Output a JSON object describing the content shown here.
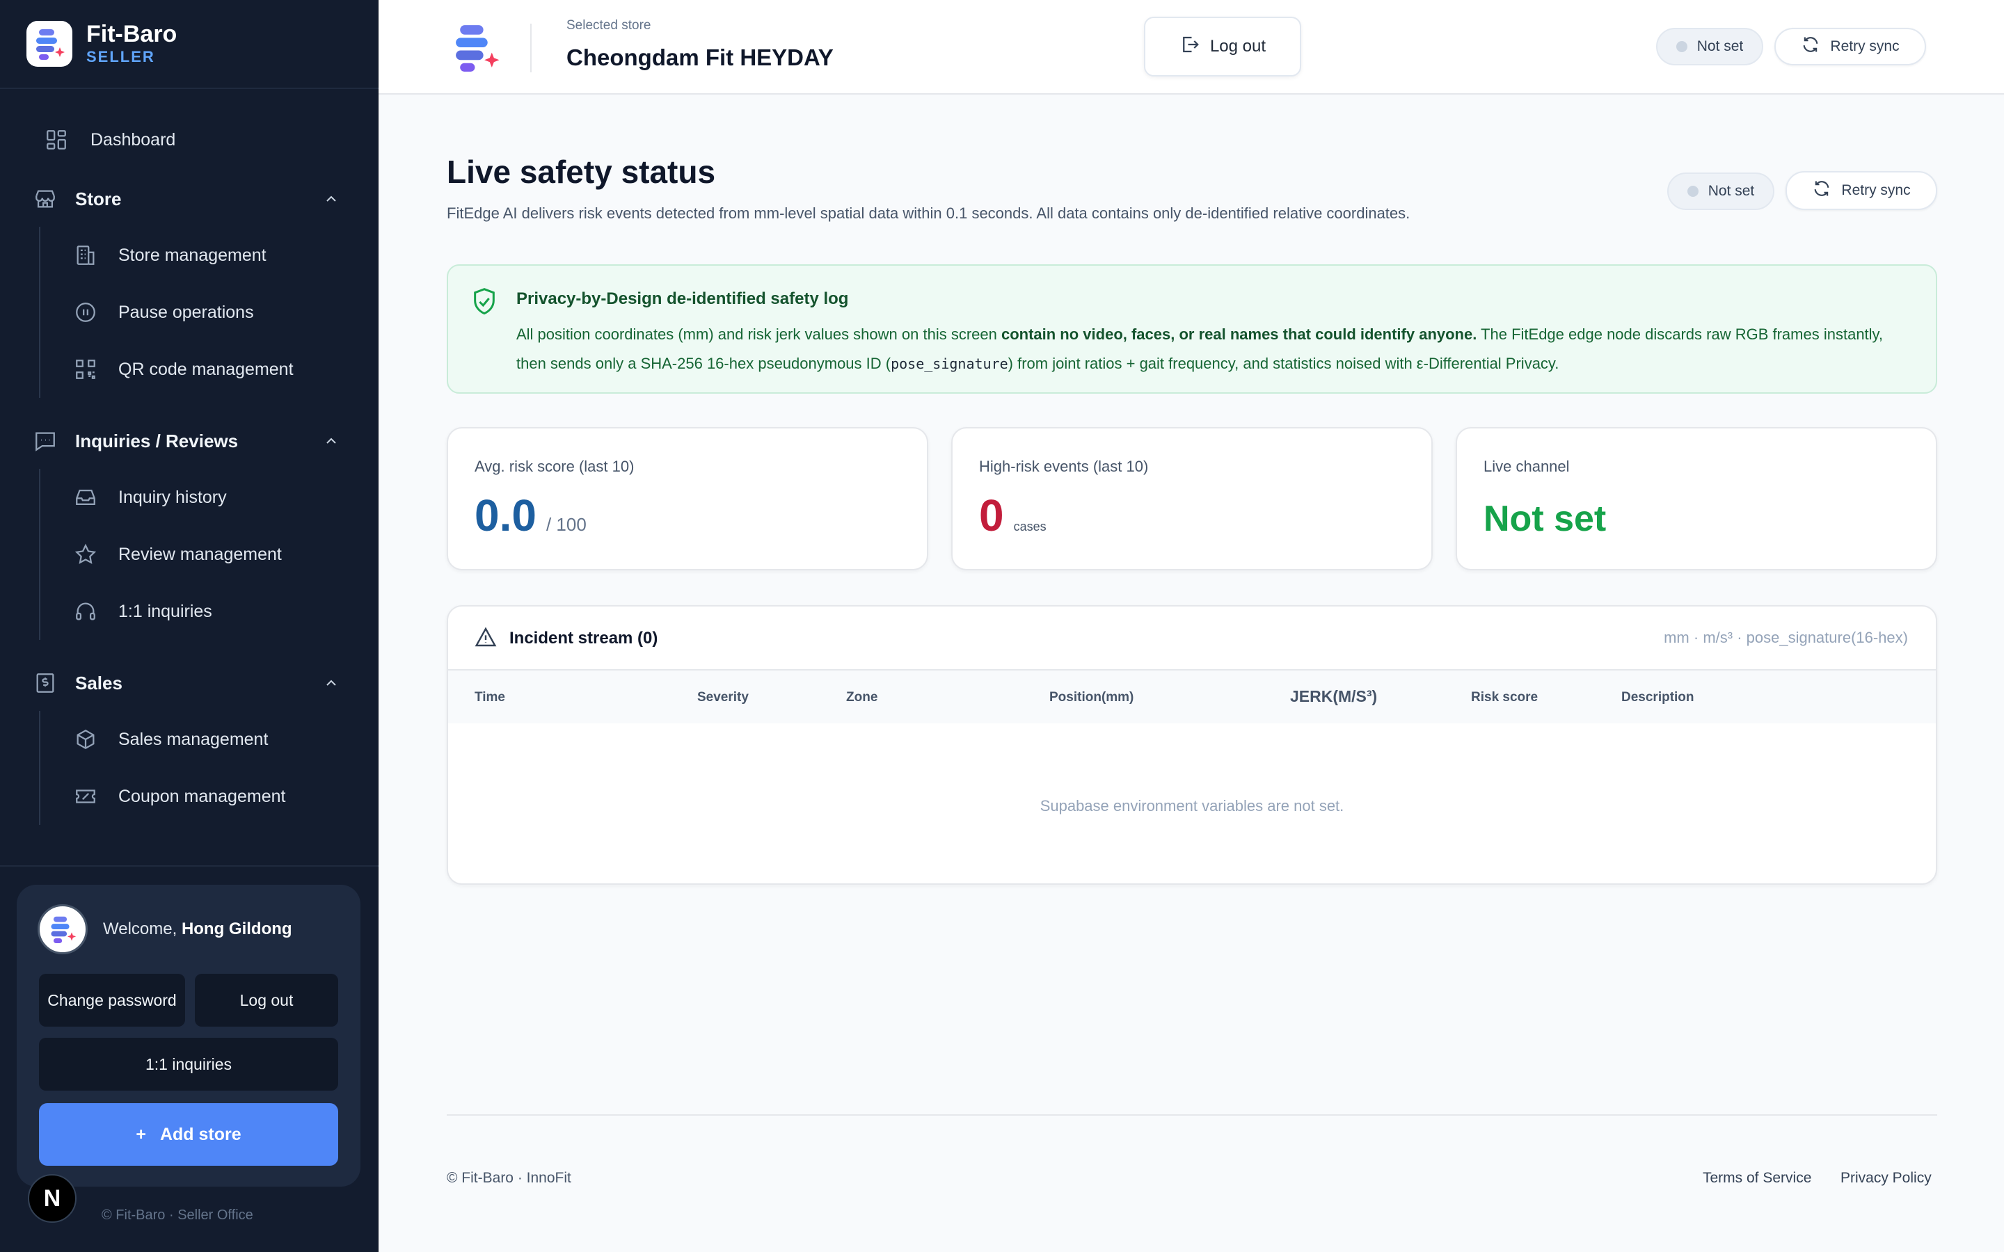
{
  "brand": {
    "name": "Fit-Baro",
    "sub": "SELLER"
  },
  "sidebar": {
    "dashboard": "Dashboard",
    "groups": [
      {
        "label": "Store",
        "items": [
          "Store management",
          "Pause operations",
          "QR code management"
        ]
      },
      {
        "label": "Inquiries / Reviews",
        "items": [
          "Inquiry history",
          "Review management",
          "1:1 inquiries"
        ]
      },
      {
        "label": "Sales",
        "items": [
          "Sales management",
          "Coupon management"
        ]
      }
    ],
    "user": {
      "welcome": "Welcome,",
      "name": "Hong Gildong",
      "change_password": "Change password",
      "logout": "Log out",
      "inquiries": "1:1 inquiries",
      "add_store": "Add store",
      "add_icon": "+"
    },
    "next_badge": "N",
    "footer": "© Fit-Baro · Seller Office"
  },
  "header": {
    "selected_label": "Selected store",
    "store_name": "Cheongdam Fit HEYDAY",
    "logout": "Log out",
    "status": "Not set",
    "retry": "Retry sync"
  },
  "main": {
    "title": "Live safety status",
    "description": "FitEdge AI delivers risk events detected from mm-level spatial data within 0.1 seconds. All data contains only de-identified relative coordinates.",
    "status": "Not set",
    "retry": "Retry sync",
    "privacy": {
      "title": "Privacy-by-Design de-identified safety log",
      "p1": "All position coordinates (mm) and risk jerk values shown on this screen ",
      "bold": "contain no video, faces, or real names that could identify anyone.",
      "p2": " The FitEdge edge node discards raw RGB frames instantly, then sends only a SHA-256 16-hex pseudonymous ID (",
      "code": "pose_signature",
      "p3": ") from joint ratios + gait frequency, and statistics noised with ε-Differential Privacy."
    },
    "stats": [
      {
        "label": "Avg. risk score (last 10)",
        "value": "0.0",
        "unit": "/ 100"
      },
      {
        "label": "High-risk events (last 10)",
        "value": "0",
        "unit": "cases"
      },
      {
        "label": "Live channel",
        "value": "Not set"
      }
    ],
    "stream": {
      "title": "Incident stream (0)",
      "units": "mm · m/s³ · pose_signature(16-hex)",
      "columns": [
        "Time",
        "Severity",
        "Zone",
        "Position(mm)",
        "JERK(M/S³)",
        "Risk score",
        "Description"
      ],
      "empty": "Supabase environment variables are not set."
    }
  },
  "footer": {
    "copyright": "© Fit-Baro · InnoFit",
    "terms": "Terms of Service",
    "privacy": "Privacy Policy"
  },
  "colors": {
    "sidebar_bg": "#131c2e",
    "accent": "#4f86f7",
    "risk_blue": "#1d5fa0",
    "risk_red": "#c21d3b",
    "live_green": "#16a34a"
  }
}
